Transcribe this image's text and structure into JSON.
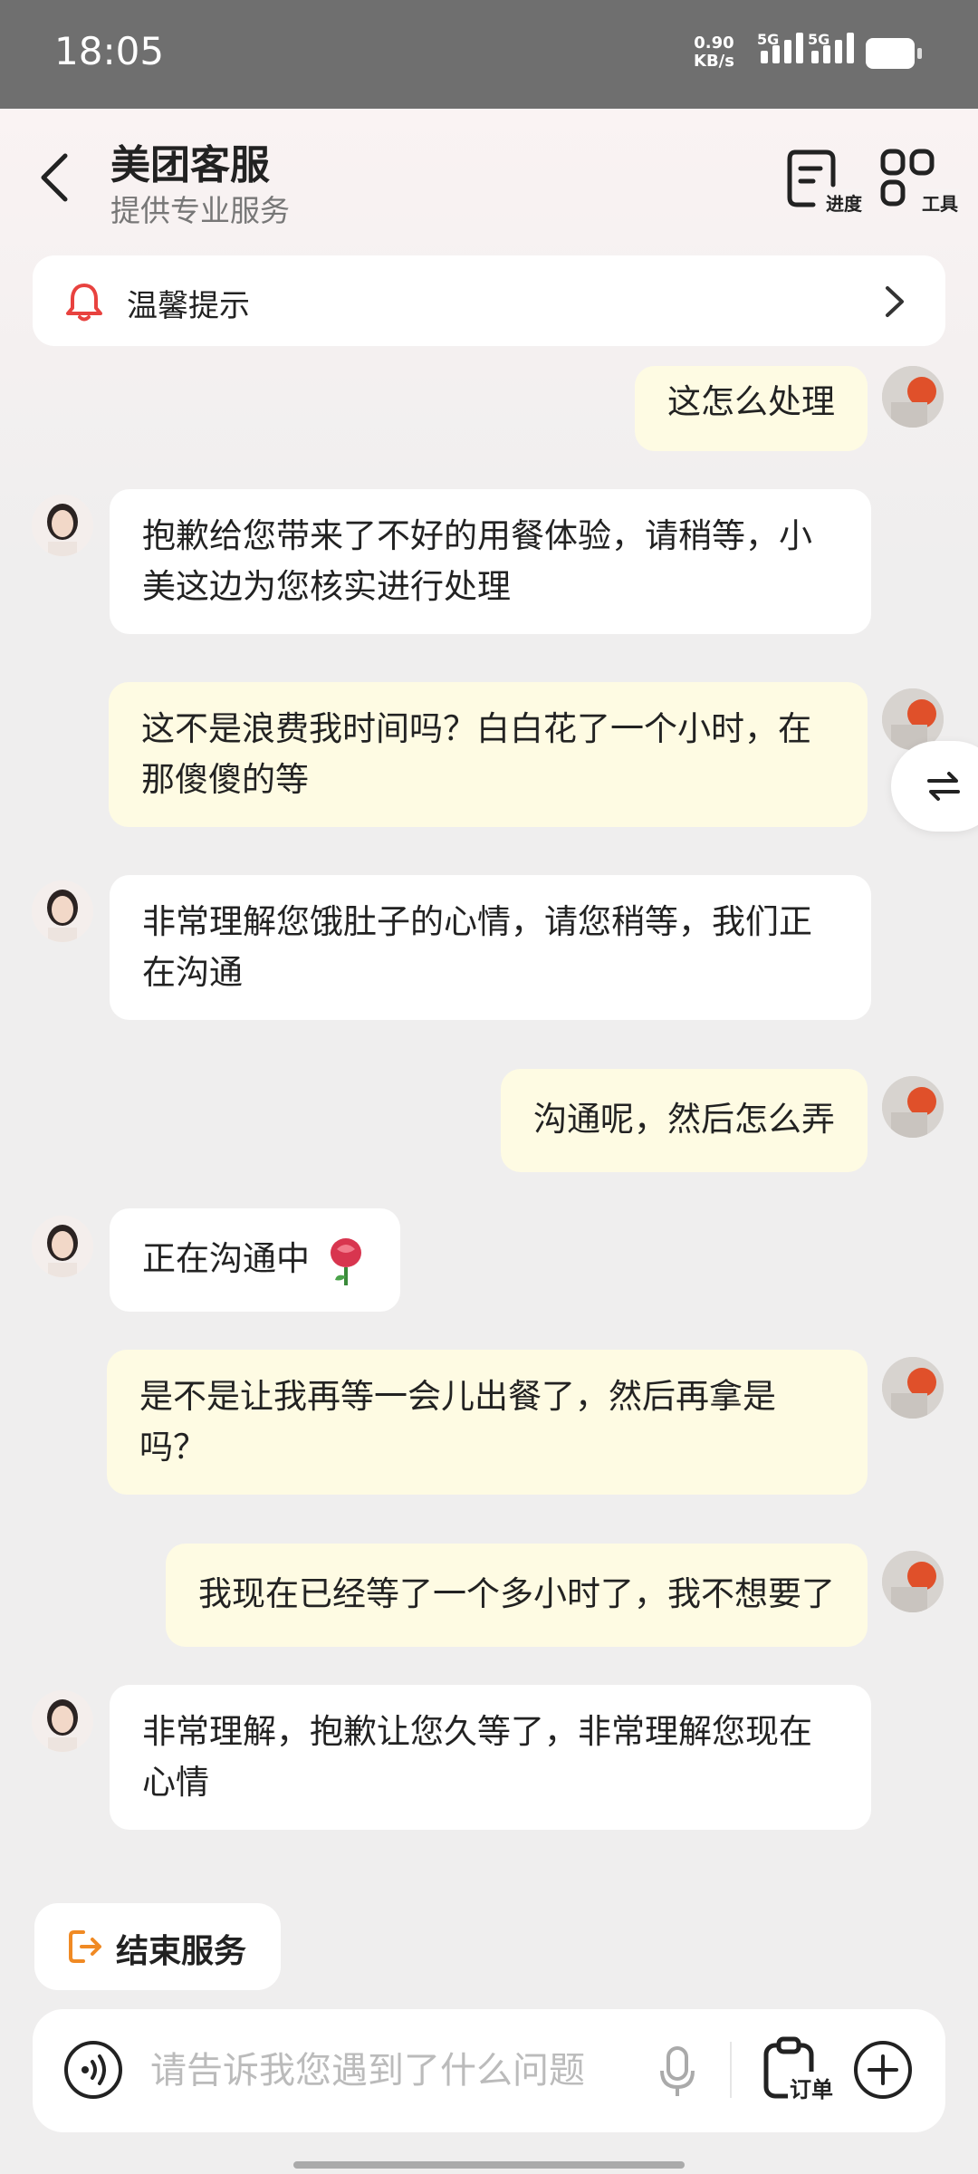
{
  "status_bar": {
    "time": "18:05",
    "net_speed": "0.90",
    "net_unit": "KB/s",
    "sim1": "5G",
    "sim2": "5G",
    "battery_icon": "battery-icon"
  },
  "header": {
    "title": "美团客服",
    "subtitle": "提供专业服务",
    "progress_label": "进度",
    "tools_label": "工具"
  },
  "notice": {
    "text": "温馨提示",
    "accent": "#e8423f"
  },
  "messages": [
    {
      "from": "user",
      "text": "这怎么处理"
    },
    {
      "from": "agent",
      "text": "抱歉给您带来了不好的用餐体验，请稍等，小美这边为您核实进行处理"
    },
    {
      "from": "user",
      "text": "这不是浪费我时间吗？白白花了一个小时，在那傻傻的等"
    },
    {
      "from": "agent",
      "text": "非常理解您饿肚子的心情，请您稍等，我们正在沟通"
    },
    {
      "from": "user",
      "text": "沟通呢，然后怎么弄"
    },
    {
      "from": "agent",
      "text": "正在沟通中",
      "emoji": "rose-icon"
    },
    {
      "from": "user",
      "text": "是不是让我再等一会儿出餐了，然后再拿是吗？"
    },
    {
      "from": "user",
      "text": "我现在已经等了一个多小时了，我不想要了"
    },
    {
      "from": "agent",
      "text": "非常理解，抱歉让您久等了，非常理解您现在心情"
    }
  ],
  "actions": {
    "end_service": "结束服务",
    "end_service_color": "#f08a24"
  },
  "input_bar": {
    "placeholder": "请告诉我您遇到了什么问题",
    "order_label": "订单"
  },
  "colors": {
    "user_bubble": "#fefbe3",
    "agent_bubble": "#ffffff",
    "background": "#efeeee"
  }
}
